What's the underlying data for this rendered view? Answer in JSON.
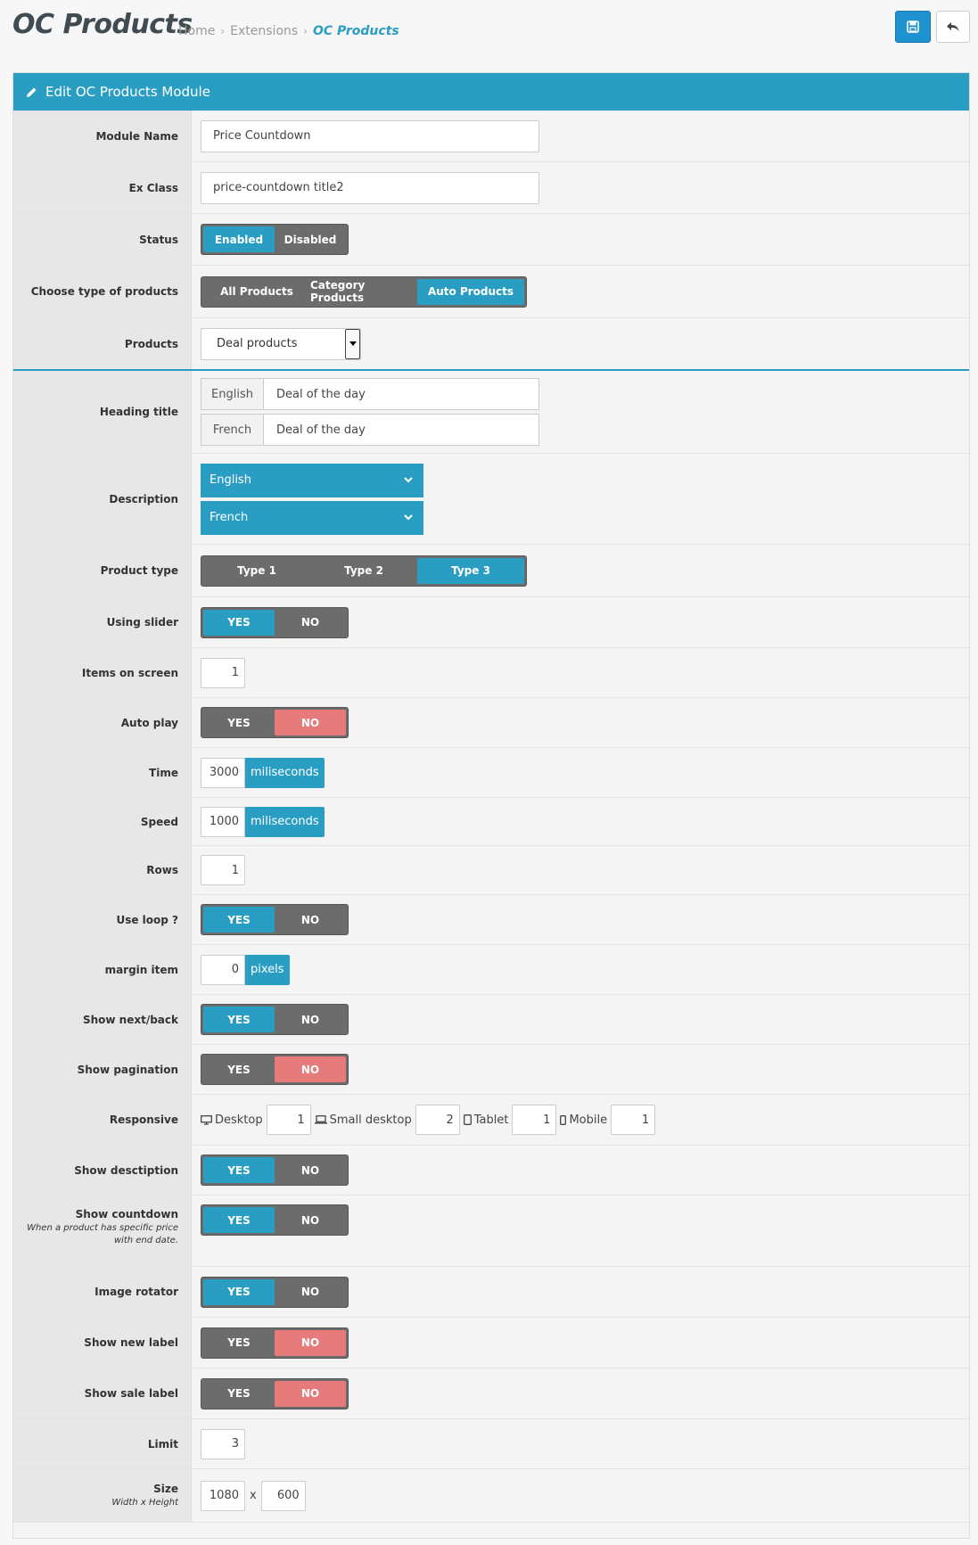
{
  "header": {
    "title": "OC Products",
    "breadcrumb": [
      "Home",
      "Extensions",
      "OC Products"
    ],
    "save_icon": "save-icon",
    "back_icon": "reply-icon"
  },
  "colors": {
    "accent": "#2a9ec2",
    "primary": "#1e91cf",
    "toggle_bg": "#6c6c6c",
    "no_active": "#e77b7b"
  },
  "panel": {
    "title": "Edit OC Products Module",
    "icon": "pencil-icon"
  },
  "fields": {
    "module_name": {
      "label": "Module Name",
      "value": "Price Countdown"
    },
    "ex_class": {
      "label": "Ex Class",
      "value": "price-countdown title2"
    },
    "status": {
      "label": "Status",
      "options": [
        "Enabled",
        "Disabled"
      ],
      "selected": "Enabled"
    },
    "product_source": {
      "label": "Choose type of products",
      "options": [
        "All Products",
        "Category Products",
        "Auto Products"
      ],
      "selected": "Auto Products"
    },
    "products": {
      "label": "Products",
      "value": "Deal products"
    },
    "heading_title": {
      "label": "Heading title",
      "items": [
        {
          "lang": "English",
          "value": "Deal of the day"
        },
        {
          "lang": "French",
          "value": "Deal of the day"
        }
      ]
    },
    "description": {
      "label": "Description",
      "items": [
        "English",
        "French"
      ]
    },
    "product_type": {
      "label": "Product type",
      "options": [
        "Type 1",
        "Type 2",
        "Type 3"
      ],
      "selected": "Type 3"
    },
    "using_slider": {
      "label": "Using slider",
      "selected": "YES"
    },
    "items_on_screen": {
      "label": "Items on screen",
      "value": "1"
    },
    "auto_play": {
      "label": "Auto play",
      "selected": "NO"
    },
    "time": {
      "label": "Time",
      "value": "3000",
      "unit": "miliseconds"
    },
    "speed": {
      "label": "Speed",
      "value": "1000",
      "unit": "miliseconds"
    },
    "rows": {
      "label": "Rows",
      "value": "1"
    },
    "use_loop": {
      "label": "Use loop ?",
      "selected": "YES"
    },
    "margin_item": {
      "label": "margin item",
      "value": "0",
      "unit": "pixels"
    },
    "show_next_back": {
      "label": "Show next/back",
      "selected": "YES"
    },
    "show_pagination": {
      "label": "Show pagination",
      "selected": "NO"
    },
    "responsive": {
      "label": "Responsive",
      "items": [
        {
          "icon": "desktop-icon",
          "label": "Desktop",
          "value": "1"
        },
        {
          "icon": "laptop-icon",
          "label": "Small desktop",
          "value": "2"
        },
        {
          "icon": "tablet-icon",
          "label": "Tablet",
          "value": "1"
        },
        {
          "icon": "mobile-icon",
          "label": "Mobile",
          "value": "1"
        }
      ]
    },
    "show_description": {
      "label": "Show desctiption",
      "selected": "YES"
    },
    "show_countdown": {
      "label": "Show countdown",
      "help": "When a product has specific price with end date.",
      "selected": "YES"
    },
    "image_rotator": {
      "label": "Image rotator",
      "selected": "YES"
    },
    "show_new_label": {
      "label": "Show new label",
      "selected": "NO"
    },
    "show_sale_label": {
      "label": "Show sale label",
      "selected": "NO"
    },
    "limit": {
      "label": "Limit",
      "value": "3"
    },
    "size": {
      "label": "Size",
      "help": "Width x Height",
      "width": "1080",
      "separator": "x",
      "height": "600"
    }
  },
  "yes_no": {
    "yes": "YES",
    "no": "NO"
  }
}
